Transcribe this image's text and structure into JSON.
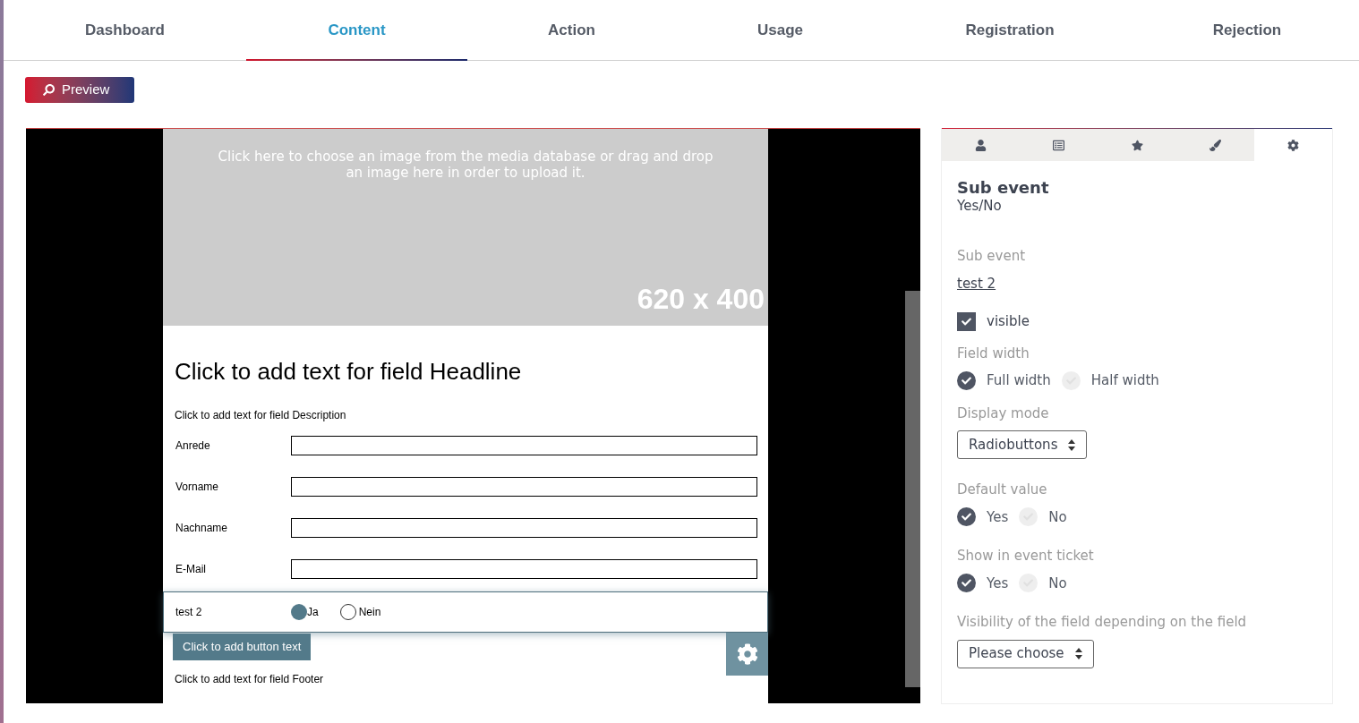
{
  "tabs": [
    {
      "label": "Dashboard",
      "selected": false
    },
    {
      "label": "Content",
      "selected": true
    },
    {
      "label": "Action",
      "selected": false
    },
    {
      "label": "Usage",
      "selected": false
    },
    {
      "label": "Registration",
      "selected": false
    },
    {
      "label": "Rejection",
      "selected": false
    }
  ],
  "preview_button": "Preview",
  "editor": {
    "image_hint": "Click here to choose an image from the media database or drag and drop an image here in order to upload it.",
    "image_size": "620 x 400",
    "headline": "Click to add text for field Headline",
    "description": "Click to add text for field Description",
    "fields": [
      {
        "label": "Anrede"
      },
      {
        "label": "Vorname"
      },
      {
        "label": "Nachname"
      },
      {
        "label": "E-Mail"
      }
    ],
    "selected_field": {
      "label": "test 2",
      "options": [
        {
          "label": "Ja",
          "selected": true
        },
        {
          "label": "Nein",
          "selected": false
        }
      ]
    },
    "button_text": "Click to add button text",
    "footer": "Click to add text for field Footer"
  },
  "panel": {
    "icon_tabs": [
      {
        "kind": "person",
        "selected": false
      },
      {
        "kind": "list",
        "selected": false
      },
      {
        "kind": "star",
        "selected": false
      },
      {
        "kind": "brush",
        "selected": false
      },
      {
        "kind": "gear",
        "selected": true
      }
    ],
    "title": "Sub event",
    "subtitle": "Yes/No",
    "sub_event_label": "Sub event",
    "sub_event_link": "test 2",
    "visible": {
      "label": "visible",
      "checked": true
    },
    "field_width": {
      "label": "Field width",
      "options": [
        {
          "label": "Full width",
          "selected": true
        },
        {
          "label": "Half width",
          "selected": false
        }
      ]
    },
    "display_mode": {
      "label": "Display mode",
      "value": "Radiobuttons"
    },
    "default_value": {
      "label": "Default value",
      "options": [
        {
          "label": "Yes",
          "selected": true
        },
        {
          "label": "No",
          "selected": false
        }
      ]
    },
    "show_in_ticket": {
      "label": "Show in event ticket",
      "options": [
        {
          "label": "Yes",
          "selected": true
        },
        {
          "label": "No",
          "selected": false
        }
      ]
    },
    "visibility": {
      "label": "Visibility of the field depending on the field",
      "value": "Please choose"
    }
  }
}
